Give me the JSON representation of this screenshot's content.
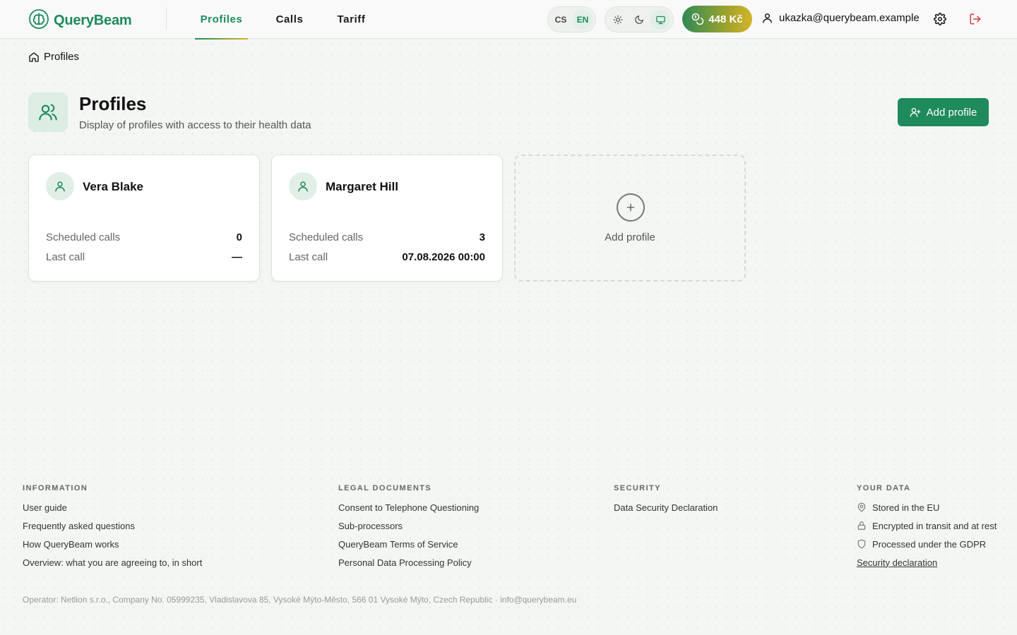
{
  "brand": {
    "name": "QueryBeam",
    "accent": "#1f8a5c",
    "gold": "#d2b52c"
  },
  "nav": {
    "tabs": [
      {
        "label": "Profiles",
        "active": true
      },
      {
        "label": "Calls",
        "active": false
      },
      {
        "label": "Tariff",
        "active": false
      }
    ]
  },
  "lang": {
    "options": [
      "CS",
      "EN"
    ],
    "selected": "EN"
  },
  "theme": {
    "options": [
      "sun-icon",
      "moon-icon",
      "monitor-icon"
    ],
    "selected": "monitor-icon"
  },
  "credit": {
    "amount": "448 Kč"
  },
  "user": {
    "email": "ukazka@querybeam.example"
  },
  "breadcrumb": {
    "label": "Profiles"
  },
  "page": {
    "title": "Profiles",
    "subtitle": "Display of profiles with access to their health data",
    "add_button": "Add profile"
  },
  "profiles": [
    {
      "name": "Vera Blake",
      "scheduled_label": "Scheduled calls",
      "scheduled": "0",
      "last_label": "Last call",
      "last": "—"
    },
    {
      "name": "Margaret Hill",
      "scheduled_label": "Scheduled calls",
      "scheduled": "3",
      "last_label": "Last call",
      "last": "07.08.2026 00:00"
    }
  ],
  "add_card": {
    "label": "Add profile"
  },
  "footer": {
    "information": {
      "heading": "INFORMATION",
      "links": [
        "User guide",
        "Frequently asked questions",
        "How QueryBeam works",
        "Overview: what you are agreeing to, in short"
      ]
    },
    "legal": {
      "heading": "LEGAL DOCUMENTS",
      "links": [
        "Consent to Telephone Questioning",
        "Sub-processors",
        "QueryBeam Terms of Service",
        "Personal Data Processing Policy"
      ]
    },
    "security": {
      "heading": "SECURITY",
      "links": [
        "Data Security Declaration"
      ]
    },
    "your_data": {
      "heading": "YOUR DATA",
      "items": [
        "Stored in the EU",
        "Encrypted in transit and at rest",
        "Processed under the GDPR"
      ],
      "link": "Security declaration"
    },
    "operator": "Operator: Netlion s.r.o., Company No. 05999235, Vladislavova 85, Vysoké Mýto-Město, 566 01 Vysoké Mýto, Czech Republic · info@querybeam.eu"
  }
}
